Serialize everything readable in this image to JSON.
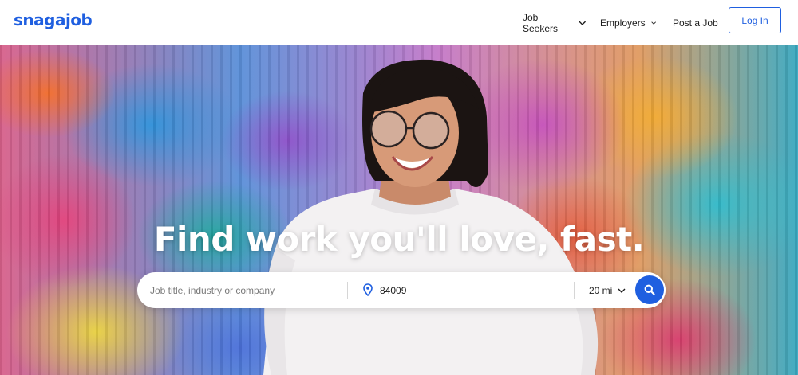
{
  "brand": {
    "name": "snagajob",
    "color": "#1f5fe0"
  },
  "nav": {
    "items": [
      {
        "label": "Job Seekers",
        "has_dropdown": true
      },
      {
        "label": "Employers",
        "has_dropdown": true
      },
      {
        "label": "Post a Job",
        "has_dropdown": false
      }
    ],
    "login_label": "Log In"
  },
  "hero": {
    "headline": "Find work you'll love, fast."
  },
  "search": {
    "job_placeholder": "Job title, industry or company",
    "job_value": "",
    "location_value": "84009",
    "radius_value": "20 mi",
    "icons": {
      "location": "map-pin-icon",
      "submit": "search-icon",
      "dropdown": "chevron-down-icon"
    }
  },
  "colors": {
    "accent": "#1f5fe0",
    "text": "#1c1c1c",
    "placeholder": "#7a7a7a"
  }
}
